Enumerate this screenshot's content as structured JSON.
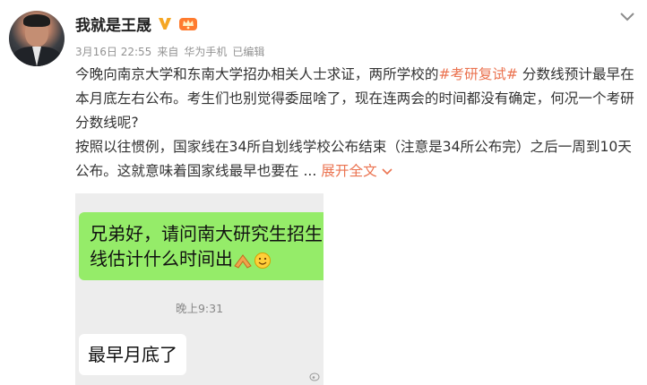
{
  "post": {
    "author_name": "我就是王晟",
    "verified_badge_icon": "verified-v-icon",
    "vip_badge_icon": "vip-crown-icon",
    "date": "3月16日 22:55",
    "source_prefix": "来自",
    "source_device": "华为手机",
    "edited_label": "已编辑",
    "para1_a": "今晚向南京大学和东南大学招办相关人士求证，两所学校的",
    "hashtag": "#考研复试#",
    "para1_b": " 分数线预计最早在本月底左右公布。考生们也别觉得委屈啥了，现在连两会的时间都没有确定，何况一个考研分数线呢?",
    "para2": "按照以往惯例，国家线在34所自划线学校公布结束（注意是34所公布完）之后一周到10天公布。这就意味着国家线最早也要在 ... ",
    "expand_label": "展开全文"
  },
  "attachment": {
    "chat_message_1": "兄弟好，请问南大研究生招生分数",
    "chat_message_1_line2": "线估计什么时间出",
    "timestamp": "晚上9:31",
    "chat_reply": "最早月底了"
  },
  "colors": {
    "accent": "#eb7350",
    "bubble_green": "#95ec69",
    "badge_gold": "#f5a623"
  }
}
